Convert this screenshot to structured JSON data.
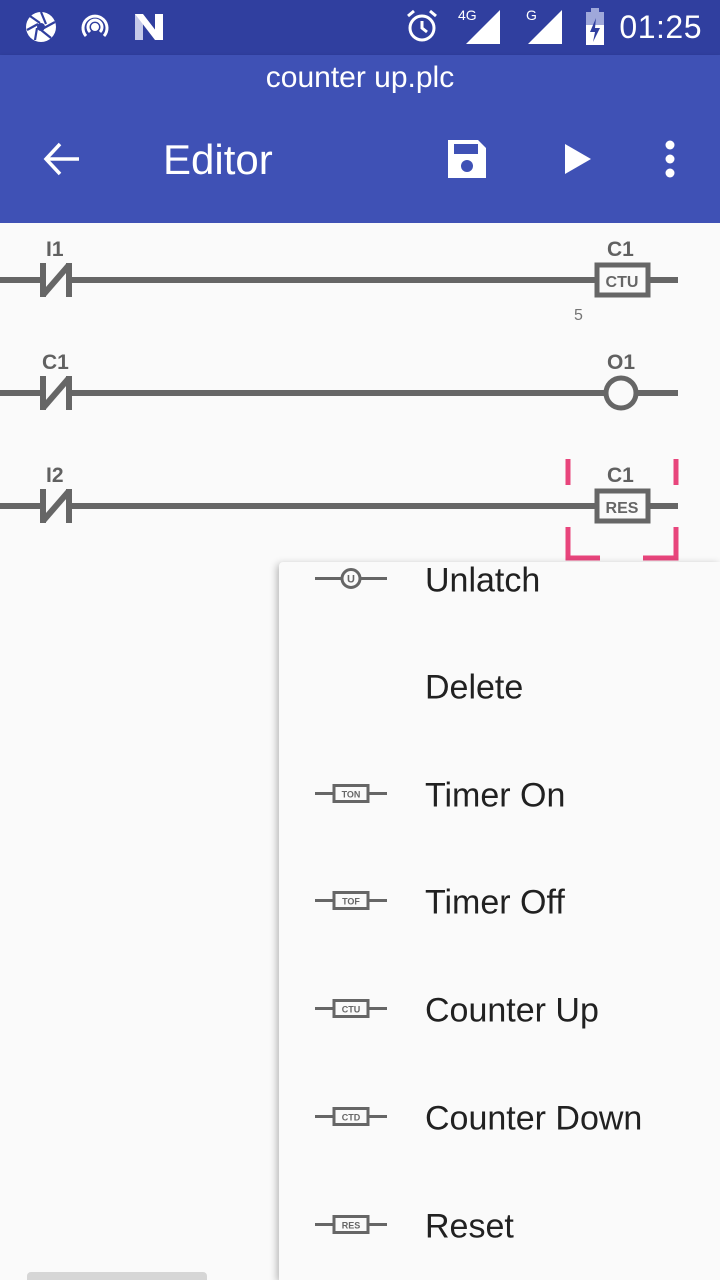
{
  "status_bar": {
    "left_icons": [
      "aperture-icon",
      "hotspot-icon",
      "n-logo-icon"
    ],
    "right_icons": [
      "alarm-icon",
      "signal-4g-icon",
      "signal-g-icon",
      "battery-charging-icon"
    ],
    "network_1": "4G",
    "network_2": "G",
    "time": "01:25"
  },
  "app_bar": {
    "file_name": "counter up.plc",
    "title": "Editor",
    "actions": [
      "back-arrow-icon",
      "save-icon",
      "play-icon",
      "more-vert-icon"
    ]
  },
  "ladder": {
    "rungs": [
      {
        "contact": {
          "type": "normally-closed",
          "label": "I1"
        },
        "output": {
          "type": "CTU",
          "label": "C1",
          "preset": "5",
          "selected": false
        }
      },
      {
        "contact": {
          "type": "normally-closed",
          "label": "C1"
        },
        "output": {
          "type": "coil",
          "label": "O1",
          "selected": false
        }
      },
      {
        "contact": {
          "type": "normally-closed",
          "label": "I2"
        },
        "output": {
          "type": "RES",
          "label": "C1",
          "selected": true
        }
      }
    ],
    "selection_color": "#e8457c",
    "wire_color": "#666666"
  },
  "menu": {
    "items": [
      {
        "label": "Unlatch",
        "icon": "unlatch-coil-icon",
        "icon_text": "U"
      },
      {
        "label": "Delete",
        "icon": "",
        "icon_text": ""
      },
      {
        "label": "Timer On",
        "icon": "timer-on-icon",
        "icon_text": "TON"
      },
      {
        "label": "Timer Off",
        "icon": "timer-off-icon",
        "icon_text": "TOF"
      },
      {
        "label": "Counter Up",
        "icon": "counter-up-icon",
        "icon_text": "CTU"
      },
      {
        "label": "Counter Down",
        "icon": "counter-down-icon",
        "icon_text": "CTD"
      },
      {
        "label": "Reset",
        "icon": "reset-icon",
        "icon_text": "RES"
      }
    ]
  },
  "colors": {
    "status_bar": "#303f9f",
    "app_bar": "#3f51b5",
    "background": "#fafafa"
  }
}
